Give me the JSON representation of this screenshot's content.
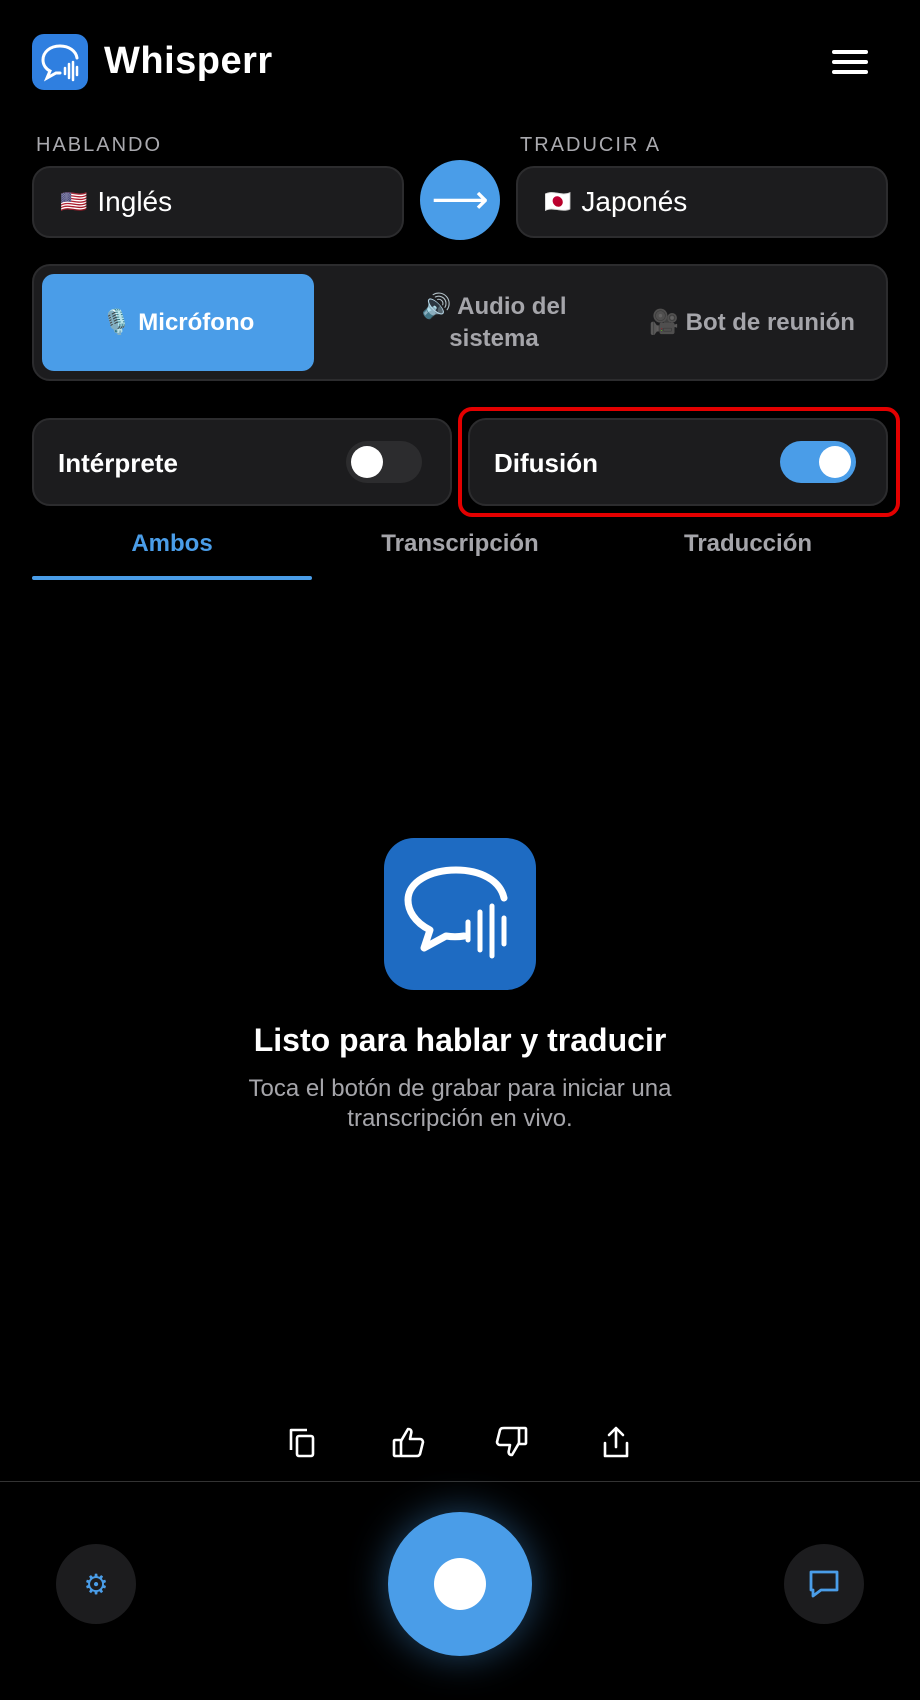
{
  "app": {
    "title": "Whisperr",
    "logo_icon": "speech-bubble-waveform-icon",
    "menu_icon": "hamburger-menu-icon"
  },
  "languages": {
    "speaking_label": "HABLANDO",
    "speaking_flag": "🇺🇸",
    "speaking_value": "Inglés",
    "swap_symbol": "⟶",
    "translate_label": "TRADUCIR A",
    "translate_flag": "🇯🇵",
    "translate_value": "Japonés"
  },
  "source": {
    "options": [
      {
        "label": "🎙️ Micrófono",
        "active": true
      },
      {
        "label": "🔊 Audio del sistema",
        "active": false
      },
      {
        "label": "🎥 Bot de reunión",
        "active": false
      }
    ]
  },
  "toggles": {
    "interpreter": {
      "label": "Intérprete",
      "on": false
    },
    "broadcast": {
      "label": "Difusión",
      "on": true
    }
  },
  "tabs": [
    {
      "label": "Ambos",
      "active": true
    },
    {
      "label": "Transcripción",
      "active": false
    },
    {
      "label": "Traducción",
      "active": false
    }
  ],
  "empty_state": {
    "title": "Listo para hablar y traducir",
    "subtitle": "Toca el botón de grabar para iniciar una transcripción en vivo."
  },
  "actions": [
    "copy-icon",
    "thumbs-up-icon",
    "thumbs-down-icon",
    "share-icon"
  ],
  "bottom": {
    "settings_icon": "⚙",
    "record": "record-button",
    "chat_icon": "chat-icon"
  },
  "colors": {
    "accent": "#4a9de8",
    "background": "#000000",
    "card": "#1c1c1e",
    "highlight": "#e30000"
  }
}
